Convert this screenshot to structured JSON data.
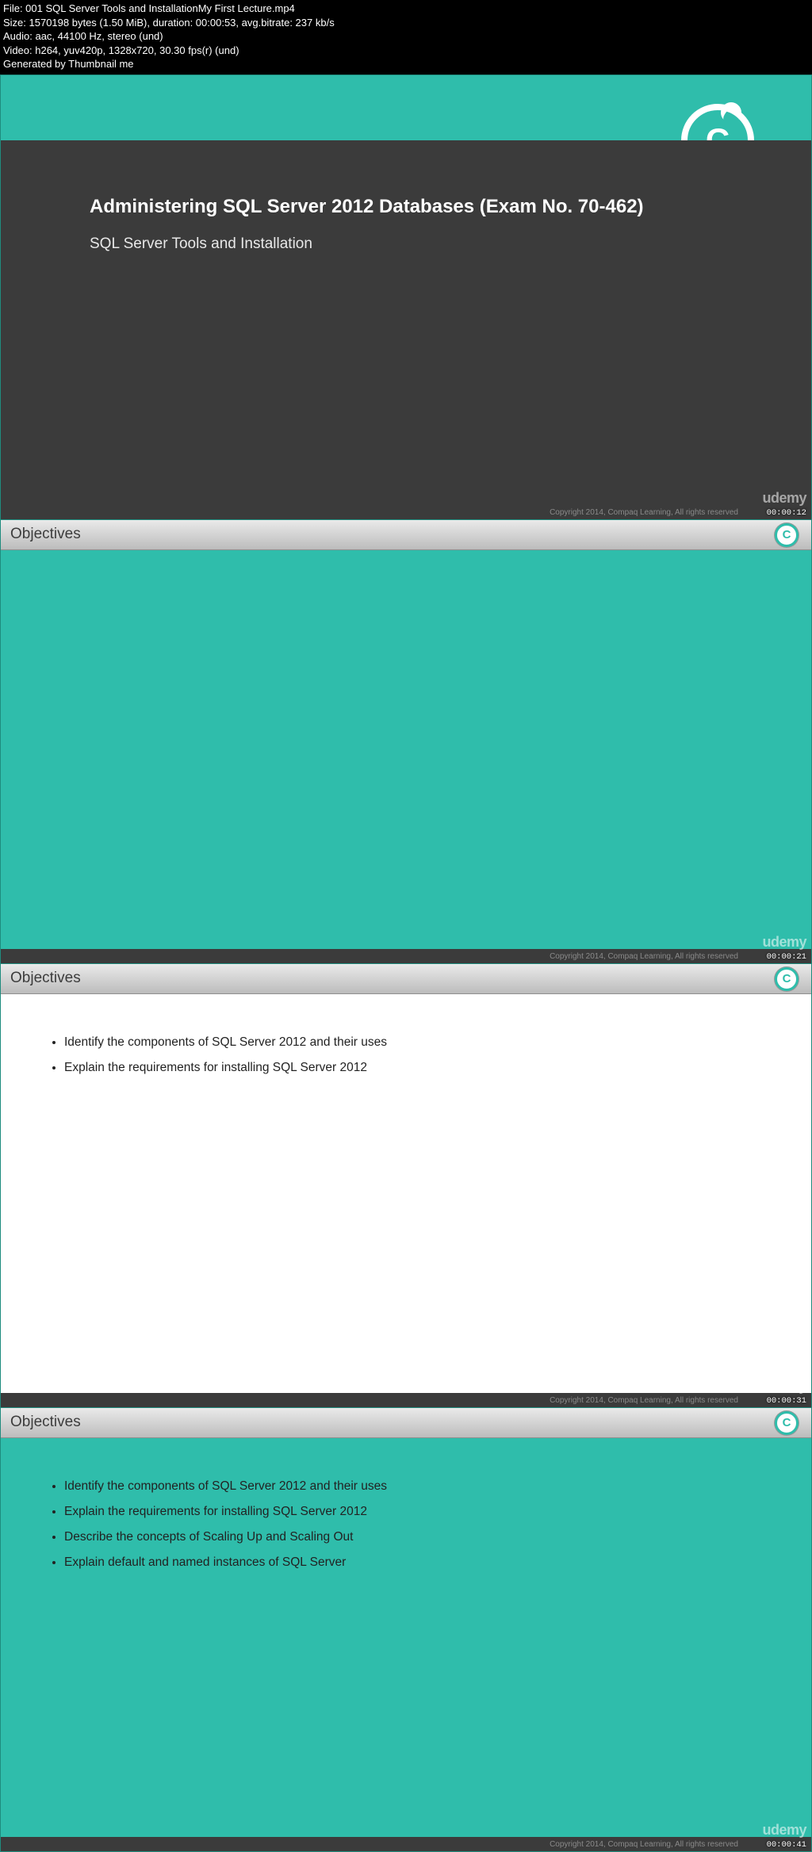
{
  "meta": {
    "line1": "File: 001 SQL Server Tools and InstallationMy First Lecture.mp4",
    "line2": "Size: 1570198 bytes (1.50 MiB), duration: 00:00:53, avg.bitrate: 237 kb/s",
    "line3": "Audio: aac, 44100 Hz, stereo (und)",
    "line4": "Video: h264, yuv420p, 1328x720, 30.30 fps(r) (und)",
    "line5": "Generated by Thumbnail me"
  },
  "course": {
    "title": "Administering SQL Server 2012 Databases (Exam No. 70-462)",
    "subtitle": "SQL Server Tools and Installation",
    "copyright": "Copyright 2014, Compaq Learning, All rights reserved",
    "watermark": "udemy"
  },
  "logo_letter": "C",
  "objectives_label": "Objectives",
  "frames": {
    "f1_ts": "00:00:12",
    "f2_ts": "00:00:21",
    "f3_ts": "00:00:31",
    "f4_ts": "00:00:41"
  },
  "objectives_full": [
    "Identify the components of SQL Server 2012 and their uses",
    "Explain the requirements for installing SQL Server 2012",
    "Describe the concepts of Scaling Up and Scaling Out",
    "Explain default and named instances of SQL Server"
  ],
  "frame3_count": 2,
  "frame4_count": 4
}
